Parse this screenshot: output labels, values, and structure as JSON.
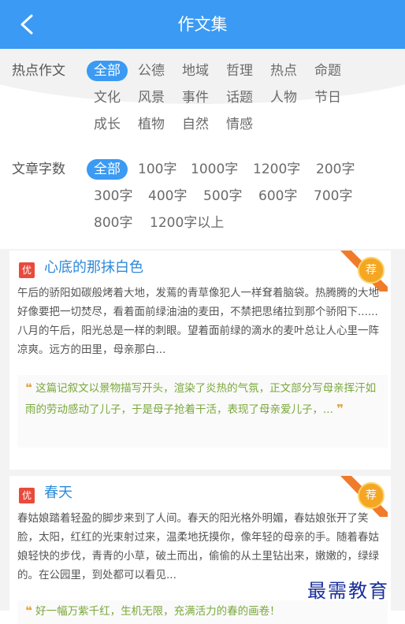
{
  "header": {
    "title": "作文集",
    "back_icon": "back-chevron-icon",
    "bg_color": "#3b9af3"
  },
  "filters": {
    "hot_label": "热点作文",
    "hot_tags": [
      "全部",
      "公德",
      "地域",
      "哲理",
      "热点",
      "命题",
      "文化",
      "风景",
      "事件",
      "话题",
      "人物",
      "节日",
      "成长",
      "植物",
      "自然",
      "情感"
    ],
    "words_label": "文章字数",
    "word_tags": [
      "全部",
      "100字",
      "1000字",
      "1200字",
      "200字",
      "300字",
      "400字",
      "500字",
      "600字",
      "700字",
      "800字",
      "1200字以上"
    ],
    "active_hot": "全部",
    "active_words": "全部"
  },
  "articles": [
    {
      "badge": "优",
      "title": "心底的那抹白色",
      "excerpt": "午后的骄阳如碳般烤着大地，发蔫的青草像犯人一样耷着脑袋。热腾腾的大地好像要把一切焚尽，看着面前绿油油的麦田，不禁把思绪拉到那个骄阳下......八月的午后，阳光总是一样的刺眼。望着面前绿的滴水的麦叶总让人心里一阵凉爽。远方的田里，母亲那白...",
      "comment": "这篇记叙文以景物描写开头，渲染了炎热的气氛，正文部分写母亲挥汗如雨的劳动感动了儿子，于是母子抢着干活，表现了母亲爱儿子，...",
      "recommend": "荐"
    },
    {
      "badge": "优",
      "title": "春天",
      "excerpt": "春姑娘踏着轻盈的脚步来到了人间。春天的阳光格外明媚，春姑娘张开了笑脸，太阳，红红的光束射过来，温柔地抚摸你，像年轻的母亲的手。随着春姑娘轻快的步伐，青青的小草，破土而出，偷偷的从土里钻出来，嫩嫩的，绿绿的。在公园里，到处都可以看见...",
      "comment": "好一幅万紫千红，生机无限，充满活力的春的画卷！",
      "recommend": "荐"
    }
  ],
  "watermark": "最需教育"
}
